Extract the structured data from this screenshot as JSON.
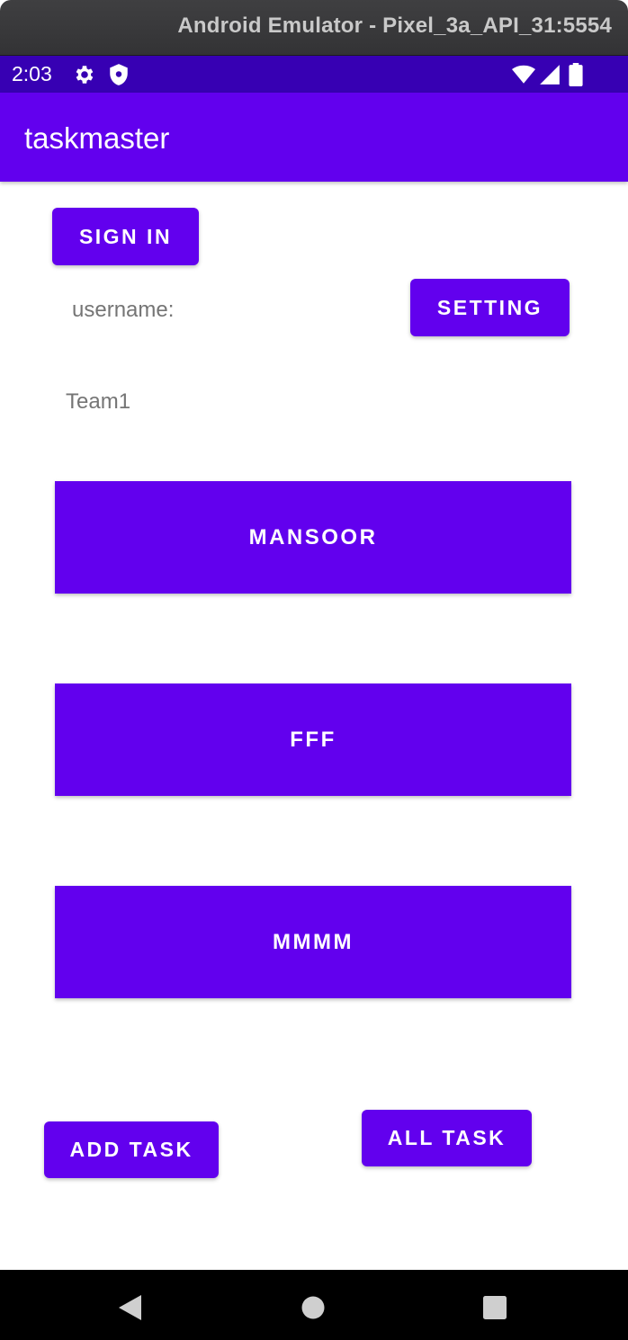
{
  "window": {
    "title": "Android Emulator - Pixel_3a_API_31:5554"
  },
  "status_bar": {
    "time": "2:03",
    "icons": [
      "gear-icon",
      "shield-icon",
      "wifi-icon",
      "signal-icon",
      "battery-icon"
    ]
  },
  "app_bar": {
    "title": "taskmaster"
  },
  "main": {
    "sign_in_label": "SIGN IN",
    "setting_label": "SETTING",
    "username_label": "username:",
    "team_label": "Team1",
    "tasks": [
      {
        "title": "MANSOOR"
      },
      {
        "title": "FFF"
      },
      {
        "title": "MMMM"
      }
    ],
    "add_task_label": "ADD TASK",
    "all_task_label": "ALL TASK"
  },
  "nav_bar": {
    "icons": [
      "back-icon",
      "home-icon",
      "recents-icon"
    ]
  },
  "colors": {
    "primary": "#6200ee",
    "primary_dark": "#3700b3",
    "label_text": "#757575"
  }
}
